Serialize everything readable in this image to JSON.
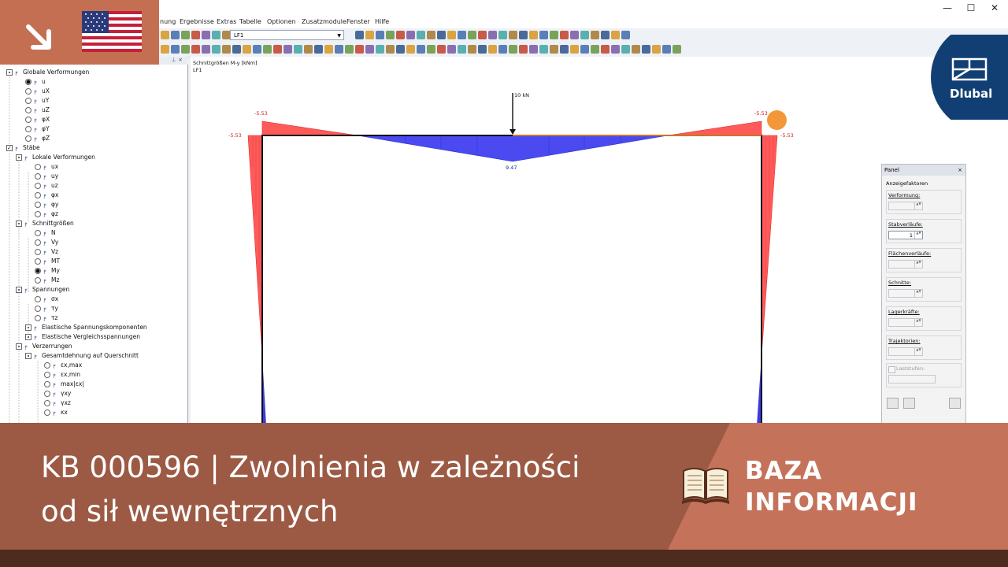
{
  "menu": {
    "items": [
      "nung",
      "Ergebnisse",
      "Extras",
      "Tabelle",
      "Optionen",
      "Zusatzmodule",
      "Fenster",
      "Hilfe"
    ]
  },
  "window_controls": {
    "minimize": "—",
    "maximize": "☐",
    "close": "✕"
  },
  "toolbar": {
    "loadcase_value": "LF1"
  },
  "navigator": {
    "pin_symbols": "⊥ ×",
    "rows": [
      {
        "label": "Globale Verformungen",
        "control": "check-tri",
        "indent": 0
      },
      {
        "label": "u",
        "control": "radio-on",
        "indent": 2
      },
      {
        "label": "uX",
        "control": "radio",
        "indent": 2
      },
      {
        "label": "uY",
        "control": "radio",
        "indent": 2
      },
      {
        "label": "uZ",
        "control": "radio",
        "indent": 2
      },
      {
        "label": "φX",
        "control": "radio",
        "indent": 2
      },
      {
        "label": "φY",
        "control": "radio",
        "indent": 2
      },
      {
        "label": "φZ",
        "control": "radio",
        "indent": 2
      },
      {
        "label": "Stäbe",
        "control": "check-on",
        "indent": 0
      },
      {
        "label": "Lokale Verformungen",
        "control": "check-tri",
        "indent": 1
      },
      {
        "label": "ux",
        "control": "radio",
        "indent": 3
      },
      {
        "label": "uy",
        "control": "radio",
        "indent": 3
      },
      {
        "label": "uz",
        "control": "radio",
        "indent": 3
      },
      {
        "label": "φx",
        "control": "radio",
        "indent": 3
      },
      {
        "label": "φy",
        "control": "radio",
        "indent": 3
      },
      {
        "label": "φz",
        "control": "radio",
        "indent": 3
      },
      {
        "label": "Schnittgrößen",
        "control": "check-tri",
        "indent": 1
      },
      {
        "label": "N",
        "control": "radio",
        "indent": 3
      },
      {
        "label": "Vy",
        "control": "radio",
        "indent": 3
      },
      {
        "label": "Vz",
        "control": "radio",
        "indent": 3
      },
      {
        "label": "MT",
        "control": "radio",
        "indent": 3
      },
      {
        "label": "My",
        "control": "radio-on",
        "indent": 3
      },
      {
        "label": "Mz",
        "control": "radio",
        "indent": 3
      },
      {
        "label": "Spannungen",
        "control": "check-tri",
        "indent": 1
      },
      {
        "label": "σx",
        "control": "radio",
        "indent": 3
      },
      {
        "label": "τy",
        "control": "radio",
        "indent": 3
      },
      {
        "label": "τz",
        "control": "radio",
        "indent": 3
      },
      {
        "label": "Elastische Spannungskomponenten",
        "control": "check-tri",
        "indent": 2
      },
      {
        "label": "Elastische Vergleichsspannungen",
        "control": "check-tri",
        "indent": 2
      },
      {
        "label": "Verzerrungen",
        "control": "check-tri",
        "indent": 1
      },
      {
        "label": "Gesamtdehnung auf Querschnitt",
        "control": "check-tri",
        "indent": 2
      },
      {
        "label": "εx,max",
        "control": "radio",
        "indent": 4
      },
      {
        "label": "εx,min",
        "control": "radio",
        "indent": 4
      },
      {
        "label": "max|εx|",
        "control": "radio",
        "indent": 4
      },
      {
        "label": "γxy",
        "control": "radio",
        "indent": 4
      },
      {
        "label": "γxz",
        "control": "radio",
        "indent": 4
      },
      {
        "label": "κx",
        "control": "radio",
        "indent": 4
      }
    ]
  },
  "viewport": {
    "title": "Schnittgrößen M-y [kNm]",
    "loadcase": "LF1",
    "load_label": "10 kN",
    "values": {
      "left_top_outer": "-5.53",
      "left_corner": "-5.53",
      "midspan": "9.47",
      "right_top_outer": "-5.53",
      "right_corner": "-5.53"
    },
    "colors": {
      "negative": "#ff4b4b",
      "positive": "#3a3ae6",
      "frame": "#111111"
    }
  },
  "panel": {
    "title": "Panel",
    "close": "×",
    "section": "Anzeigefaktoren",
    "fields": [
      {
        "label": "Verformung:",
        "value": "",
        "enabled": false
      },
      {
        "label": "Stabverläufe:",
        "value": "1",
        "enabled": true
      },
      {
        "label": "Flächenverläufe:",
        "value": "",
        "enabled": false
      },
      {
        "label": "Schnitte:",
        "value": "",
        "enabled": false
      },
      {
        "label": "Lagerkräfte:",
        "value": "",
        "enabled": false
      },
      {
        "label": "Trajektorien:",
        "value": "",
        "enabled": false
      }
    ],
    "laststufen_label": "Laststufen:"
  },
  "banner": {
    "title_line1": "KB 000596 | Zwolnienia w zależności",
    "title_line2": "od sił wewnętrznych",
    "category_line1": "BAZA",
    "category_line2": "INFORMACJI",
    "logo_text": "Dlubal",
    "colors": {
      "dark": "#9c5a44",
      "light": "#c4735a",
      "footer": "#4e2b1f",
      "logo": "#123f73"
    }
  }
}
